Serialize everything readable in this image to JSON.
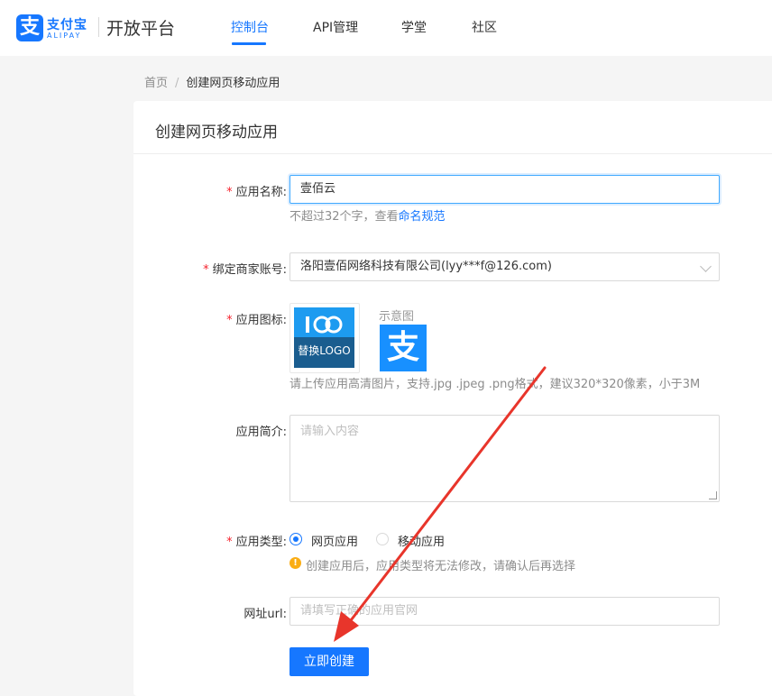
{
  "header": {
    "logo_glyph": "支",
    "logo_name": "支付宝",
    "logo_en": "ALIPAY",
    "platform": "开放平台",
    "nav": [
      {
        "label": "控制台",
        "active": true
      },
      {
        "label": "API管理",
        "active": false
      },
      {
        "label": "学堂",
        "active": false
      },
      {
        "label": "社区",
        "active": false
      }
    ]
  },
  "breadcrumb": {
    "home": "首页",
    "separator": "/",
    "current": "创建网页移动应用"
  },
  "form": {
    "title": "创建网页移动应用",
    "required_mark": "*",
    "app_name": {
      "label": "应用名称:",
      "value": "壹佰云",
      "help_prefix": "不超过32个字，查看",
      "help_link": "命名规范"
    },
    "merchant": {
      "label": "绑定商家账号:",
      "value": "洛阳壹佰网络科技有限公司(lyy***f@126.com)"
    },
    "icon": {
      "label": "应用图标:",
      "upload_text": "替换LOGO",
      "sample_label": "示意图",
      "sample_glyph": "支",
      "help": "请上传应用高清图片，支持.jpg .jpeg .png格式，建议320*320像素，小于3M"
    },
    "description": {
      "label": "应用简介:",
      "placeholder": "请输入内容"
    },
    "app_type": {
      "label": "应用类型:",
      "options": [
        {
          "label": "网页应用",
          "selected": true
        },
        {
          "label": "移动应用",
          "selected": false
        }
      ],
      "warning_glyph": "!",
      "warning": "创建应用后，应用类型将无法修改，请确认后再选择"
    },
    "url": {
      "label": "网址url:",
      "placeholder": "请填写正确的应用官网"
    },
    "submit_label": "立即创建"
  },
  "colors": {
    "accent": "#1677ff",
    "required": "#f5222d",
    "annotation_arrow": "#e8352b"
  }
}
